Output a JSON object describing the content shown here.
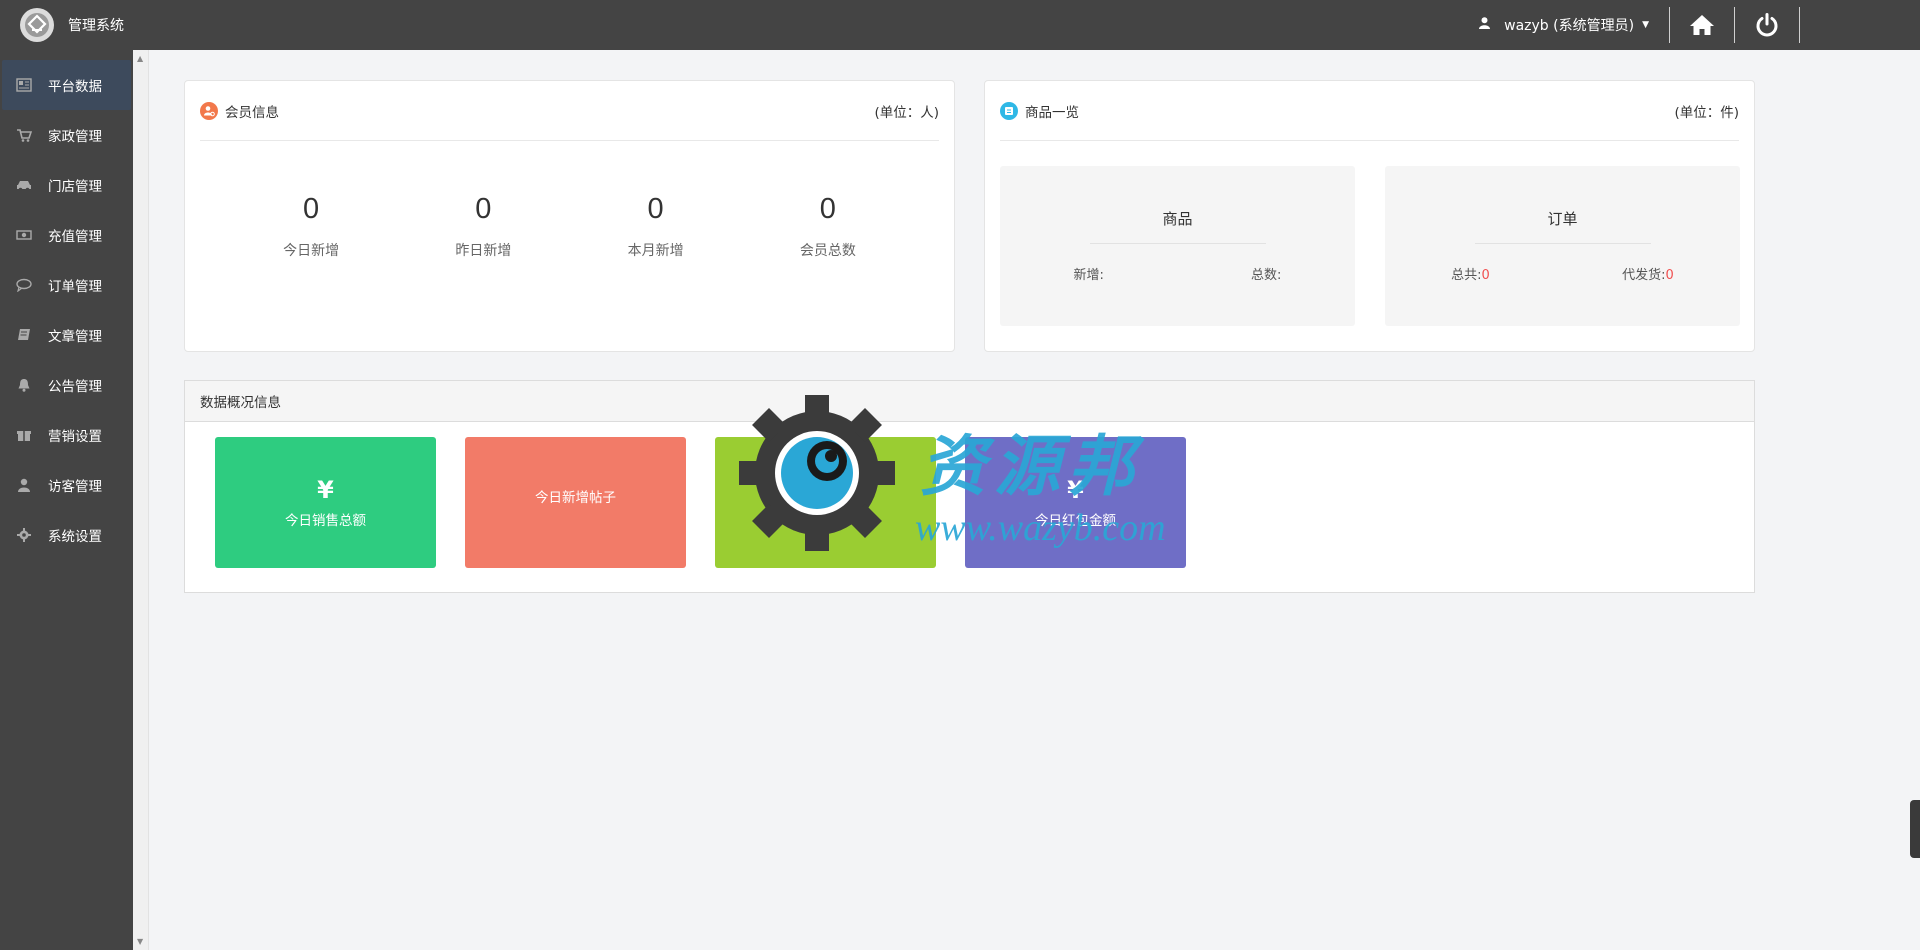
{
  "header": {
    "brand_title": "管理系统",
    "user_label": "wazyb (系统管理员)"
  },
  "sidebar": {
    "items": [
      {
        "label": "平台数据",
        "icon": "dashboard-icon",
        "active": true
      },
      {
        "label": "家政管理",
        "icon": "cart-icon"
      },
      {
        "label": "门店管理",
        "icon": "car-icon"
      },
      {
        "label": "充值管理",
        "icon": "money-icon"
      },
      {
        "label": "订单管理",
        "icon": "comment-icon"
      },
      {
        "label": "文章管理",
        "icon": "book-icon"
      },
      {
        "label": "公告管理",
        "icon": "bell-icon"
      },
      {
        "label": "营销设置",
        "icon": "gift-icon"
      },
      {
        "label": "访客管理",
        "icon": "user-icon"
      },
      {
        "label": "系统设置",
        "icon": "gear-icon"
      }
    ]
  },
  "member_card": {
    "title": "会员信息",
    "unit": "(单位：人)",
    "stats": [
      {
        "value": "0",
        "label": "今日新增"
      },
      {
        "value": "0",
        "label": "昨日新增"
      },
      {
        "value": "0",
        "label": "本月新增"
      },
      {
        "value": "0",
        "label": "会员总数"
      }
    ]
  },
  "goods_card": {
    "title": "商品一览",
    "unit": "(单位：件)",
    "goods": {
      "title": "商品",
      "new_label": "新增:",
      "total_label": "总数:"
    },
    "orders": {
      "title": "订单",
      "total_label": "总共:",
      "total_value": "0",
      "pending_label": "代发货:",
      "pending_value": "0"
    }
  },
  "overview": {
    "title": "数据概况信息",
    "tiles": [
      {
        "symbol": "¥",
        "label": "今日销售总额",
        "color": "#2ecc80"
      },
      {
        "symbol": "",
        "label": "今日新增帖子",
        "color": "#f27b68"
      },
      {
        "symbol": "",
        "label": "",
        "color": "#9acd32"
      },
      {
        "symbol": "¥",
        "label": "今日红包金额",
        "color": "#6f6ec6"
      }
    ]
  },
  "watermark": {
    "title": "资源邦",
    "url": "www.wazyb.com"
  },
  "colors": {
    "topbar": "#444444",
    "sidebar": "#444444",
    "active_item": "#3d4a5c",
    "accent_red": "#f05050"
  }
}
